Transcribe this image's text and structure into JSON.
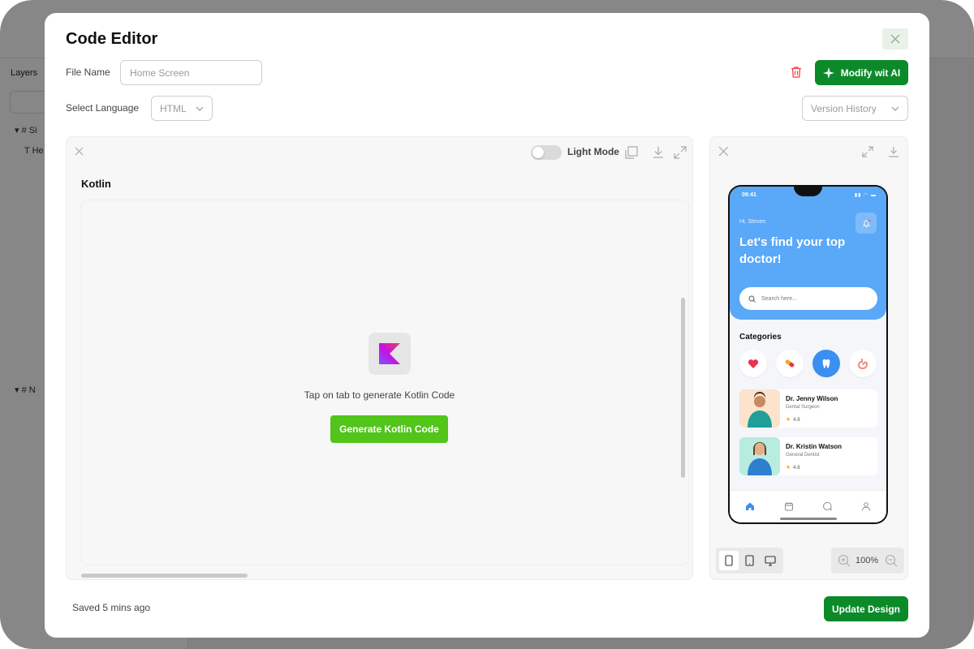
{
  "background_app": {
    "layers_title": "Layers",
    "layer_rows": [
      "Si",
      "He",
      "N"
    ]
  },
  "modal": {
    "title": "Code Editor",
    "file_name_label": "File Name",
    "file_name_value": "Home Screen",
    "select_language_label": "Select Language",
    "language_value": "HTML",
    "modify_ai_label": "Modify wit AI",
    "version_history_label": "Version History",
    "saved_text": "Saved 5 mins ago",
    "update_button": "Update Design"
  },
  "editor": {
    "light_mode_label": "Light Mode",
    "language_title": "Kotlin",
    "empty_message": "Tap on tab to generate Kotlin Code",
    "generate_button": "Generate Kotlin Code"
  },
  "preview": {
    "zoom": "100%",
    "phone": {
      "time": "09:41",
      "greeting": "Hi, Steven",
      "headline": "Let's find your top doctor!",
      "search_placeholder": "Search here...",
      "categories_title": "Categories",
      "categories": [
        "heart-icon",
        "pill-icon",
        "tooth-icon",
        "stomach-icon"
      ],
      "doctors": [
        {
          "name": "Dr. Jenny Wilson",
          "role": "Dental Surgeon",
          "rating": "4.8"
        },
        {
          "name": "Dr. Kristin Watson",
          "role": "General Dentist",
          "rating": "4.8"
        }
      ]
    }
  },
  "colors": {
    "brand_green": "#0c8a2a",
    "generate_green": "#52c41a",
    "phone_blue": "#5aa8f8",
    "active_blue": "#3a8ff0"
  }
}
